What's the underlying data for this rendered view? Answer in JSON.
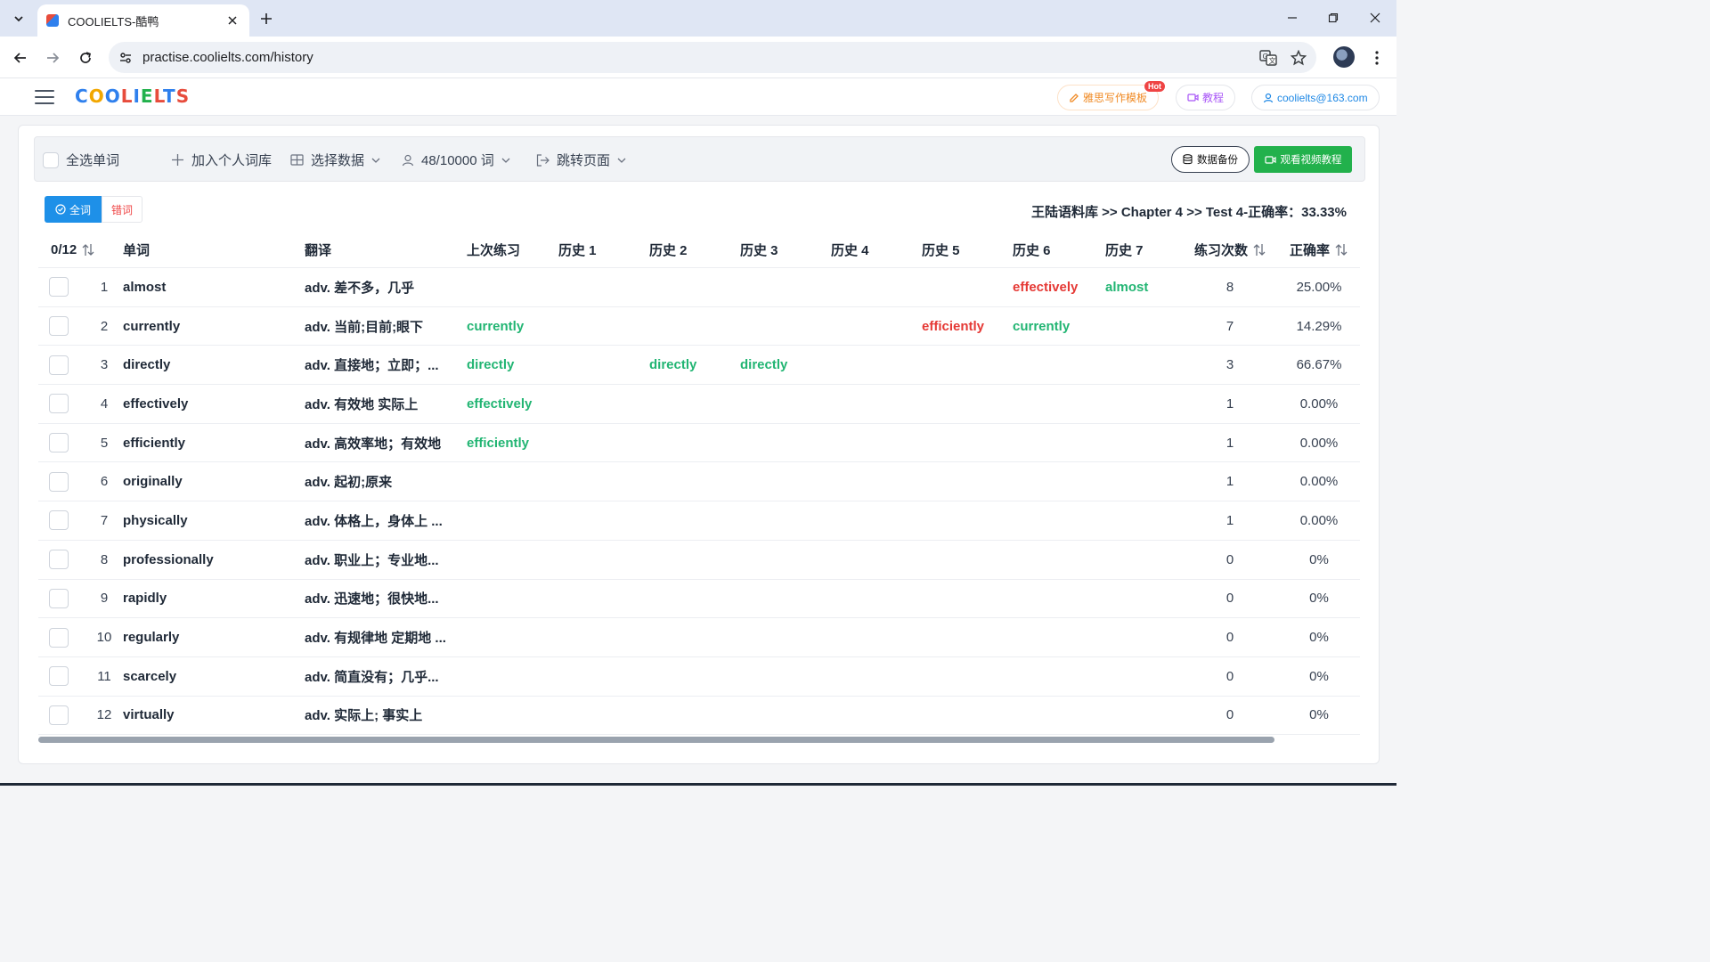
{
  "browser": {
    "tab_title": "COOLIELTS-酷鸭",
    "url": "practise.coolielts.com/history"
  },
  "header": {
    "logo_text": "COOLIELTS",
    "logo_colors": [
      "#2f80ed",
      "#f2a700",
      "#2f80ed",
      "#e74c3c",
      "#2f80ed",
      "#22b14c",
      "#e74c3c",
      "#2f80ed",
      "#e74c3c"
    ],
    "template_label": "雅思写作模板",
    "hot_badge": "Hot",
    "tutorial_label": "教程",
    "user_email": "coolielts@163.com"
  },
  "toolbar": {
    "select_all": "全选单词",
    "add_vocab": "加入个人词库",
    "select_data": "选择数据",
    "word_count": "48/10000 词",
    "jump_page": "跳转页面",
    "backup": "数据备份",
    "watch_video": "观看视频教程"
  },
  "filter": {
    "all_words": "全词",
    "wrong_words": "错词"
  },
  "breadcrumb": "王陆语料库 >> Chapter 4 >> Test 4-正确率：33.33%",
  "table": {
    "headers": {
      "selected": "0/12",
      "word": "单词",
      "translation": "翻译",
      "last": "上次练习",
      "h1": "历史 1",
      "h2": "历史 2",
      "h3": "历史 3",
      "h4": "历史 4",
      "h5": "历史 5",
      "h6": "历史 6",
      "h7": "历史 7",
      "count": "练习次数",
      "accuracy": "正确率"
    },
    "rows": [
      {
        "idx": "1",
        "word": "almost",
        "tr": "adv. 差不多，几乎",
        "last": "",
        "h1": "",
        "h2": "",
        "h3": "",
        "h4": "",
        "h5": "",
        "h6": "effectively",
        "h7": "almost",
        "count": "8",
        "acc": "25.00%"
      },
      {
        "idx": "2",
        "word": "currently",
        "tr": "adv. 当前;目前;眼下",
        "last": "currently",
        "h1": "",
        "h2": "",
        "h3": "",
        "h4": "",
        "h5": "efficiently",
        "h6": "currently",
        "h7": "",
        "count": "7",
        "acc": "14.29%"
      },
      {
        "idx": "3",
        "word": "directly",
        "tr": "adv. 直接地；立即；...",
        "last": "directly",
        "h1": "",
        "h2": "directly",
        "h3": "directly",
        "h4": "",
        "h5": "",
        "h6": "",
        "h7": "",
        "count": "3",
        "acc": "66.67%"
      },
      {
        "idx": "4",
        "word": "effectively",
        "tr": "adv. 有效地 实际上",
        "last": "effectively",
        "h1": "",
        "h2": "",
        "h3": "",
        "h4": "",
        "h5": "",
        "h6": "",
        "h7": "",
        "count": "1",
        "acc": "0.00%"
      },
      {
        "idx": "5",
        "word": "efficiently",
        "tr": "adv. 高效率地；有效地",
        "last": "efficiently",
        "h1": "",
        "h2": "",
        "h3": "",
        "h4": "",
        "h5": "",
        "h6": "",
        "h7": "",
        "count": "1",
        "acc": "0.00%"
      },
      {
        "idx": "6",
        "word": "originally",
        "tr": "adv. 起初;原来",
        "last": "",
        "h1": "",
        "h2": "",
        "h3": "",
        "h4": "",
        "h5": "",
        "h6": "",
        "h7": "",
        "count": "1",
        "acc": "0.00%"
      },
      {
        "idx": "7",
        "word": "physically",
        "tr": "adv. 体格上，身体上 ...",
        "last": "",
        "h1": "",
        "h2": "",
        "h3": "",
        "h4": "",
        "h5": "",
        "h6": "",
        "h7": "",
        "count": "1",
        "acc": "0.00%"
      },
      {
        "idx": "8",
        "word": "professionally",
        "tr": "adv. 职业上；专业地...",
        "last": "",
        "h1": "",
        "h2": "",
        "h3": "",
        "h4": "",
        "h5": "",
        "h6": "",
        "h7": "",
        "count": "0",
        "acc": "0%"
      },
      {
        "idx": "9",
        "word": "rapidly",
        "tr": "adv. 迅速地；很快地...",
        "last": "",
        "h1": "",
        "h2": "",
        "h3": "",
        "h4": "",
        "h5": "",
        "h6": "",
        "h7": "",
        "count": "0",
        "acc": "0%"
      },
      {
        "idx": "10",
        "word": "regularly",
        "tr": "adv. 有规律地 定期地 ...",
        "last": "",
        "h1": "",
        "h2": "",
        "h3": "",
        "h4": "",
        "h5": "",
        "h6": "",
        "h7": "",
        "count": "0",
        "acc": "0%"
      },
      {
        "idx": "11",
        "word": "scarcely",
        "tr": "adv. 简直没有；几乎...",
        "last": "",
        "h1": "",
        "h2": "",
        "h3": "",
        "h4": "",
        "h5": "",
        "h6": "",
        "h7": "",
        "count": "0",
        "acc": "0%"
      },
      {
        "idx": "12",
        "word": "virtually",
        "tr": "adv. 实际上; 事实上",
        "last": "",
        "h1": "",
        "h2": "",
        "h3": "",
        "h4": "",
        "h5": "",
        "h6": "",
        "h7": "",
        "count": "0",
        "acc": "0%"
      }
    ]
  }
}
